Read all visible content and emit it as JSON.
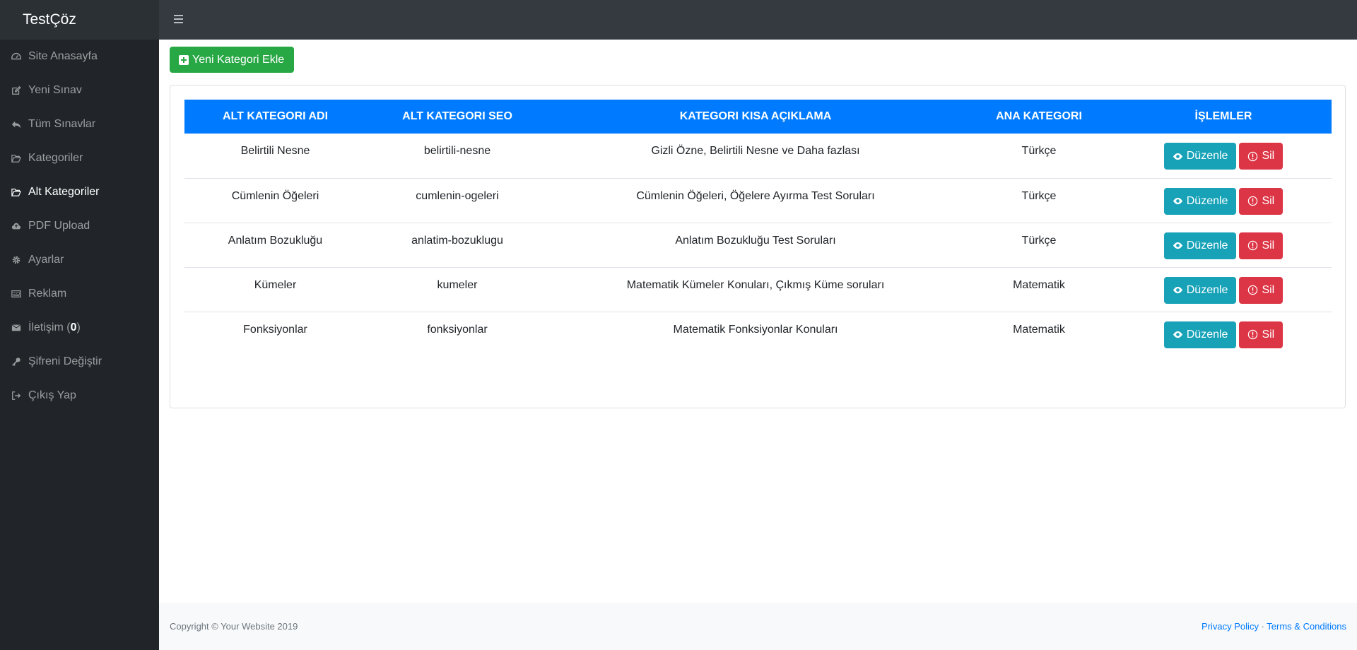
{
  "brand": "TestÇöz",
  "sidebar": {
    "items": [
      {
        "label": "Site Anasayfa",
        "icon": "dashboard-icon"
      },
      {
        "label": "Yeni Sınav",
        "icon": "edit-icon"
      },
      {
        "label": "Tüm Sınavlar",
        "icon": "reply-icon"
      },
      {
        "label": "Kategoriler",
        "icon": "folder-open-icon"
      },
      {
        "label": "Alt Kategoriler",
        "icon": "folder-open-icon"
      },
      {
        "label": "PDF Upload",
        "icon": "cloud-upload-icon"
      },
      {
        "label": "Ayarlar",
        "icon": "gear-icon"
      },
      {
        "label": "Reklam",
        "icon": "newspaper-icon"
      },
      {
        "label": "İletişim (",
        "count": "0",
        "suffix": ")",
        "icon": "envelope-icon"
      },
      {
        "label": "Şifreni Değiştir",
        "icon": "key-icon"
      },
      {
        "label": "Çıkış Yap",
        "icon": "sign-out-icon"
      }
    ]
  },
  "toolbar": {
    "add_label": "Yeni Kategori Ekle"
  },
  "table": {
    "headers": [
      "ALT KATEGORI ADI",
      "ALT KATEGORI SEO",
      "KATEGORI KISA AÇIKLAMA",
      "ANA KATEGORI",
      "İŞLEMLER"
    ],
    "rows": [
      [
        "Belirtili Nesne",
        "belirtili-nesne",
        "Gizli Özne, Belirtili Nesne ve Daha fazlası",
        "Türkçe"
      ],
      [
        "Cümlenin Öğeleri",
        "cumlenin-ogeleri",
        "Cümlenin Öğeleri, Öğelere Ayırma Test Soruları",
        "Türkçe"
      ],
      [
        "Anlatım Bozukluğu",
        "anlatim-bozuklugu",
        "Anlatım Bozukluğu Test Soruları",
        "Türkçe"
      ],
      [
        "Kümeler",
        "kumeler",
        "Matematik Kümeler Konuları, Çıkmış Küme soruları",
        "Matematik"
      ],
      [
        "Fonksiyonlar",
        "fonksiyonlar",
        "Matematik Fonksiyonlar Konuları",
        "Matematik"
      ]
    ],
    "edit_label": "Düzenle",
    "delete_label": "Sil"
  },
  "footer": {
    "copyright": "Copyright © Your Website 2019",
    "privacy": "Privacy Policy",
    "separator": " · ",
    "terms": "Terms & Conditions"
  },
  "colors": {
    "primary": "#007bff",
    "success": "#28a745",
    "info": "#17a2b8",
    "danger": "#dc3545"
  }
}
